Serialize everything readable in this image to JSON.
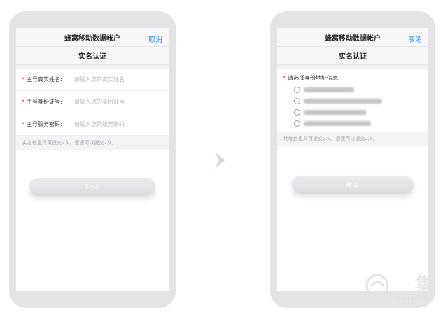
{
  "left_screen": {
    "nav_title": "蜂窝移动数据帐户",
    "cancel_label": "取消",
    "subtitle": "实名认证",
    "fields": [
      {
        "label": "主号真实姓名:",
        "placeholder": "请输入您的真实姓名"
      },
      {
        "label": "主号身份证号:",
        "placeholder": "请输入您的身份证号"
      },
      {
        "label": "主号服务密码:",
        "placeholder": "请输入您的服务密码"
      }
    ],
    "required_mark": "*",
    "notice": "实名信息只可提交2次。您还可以提交2次。",
    "next_button": "下一步"
  },
  "right_screen": {
    "nav_title": "蜂窝移动数据帐户",
    "cancel_label": "取消",
    "subtitle": "实名认证",
    "required_mark": "*",
    "address_prompt": "请选择身份地址信息:",
    "notice": "地址信息只可提交2次。您还可以提交2次。",
    "confirm_button": "确 定"
  },
  "icons": {
    "arrow": "chevron-right-icon",
    "watermark": "watermark-logo"
  },
  "watermark": {
    "text": "集",
    "subtext": "jiguo.com"
  },
  "colors": {
    "accent": "#2f7ef0",
    "required": "#e33a3a",
    "phone_frame": "#e4e4e6",
    "button": "#dcdce0"
  }
}
